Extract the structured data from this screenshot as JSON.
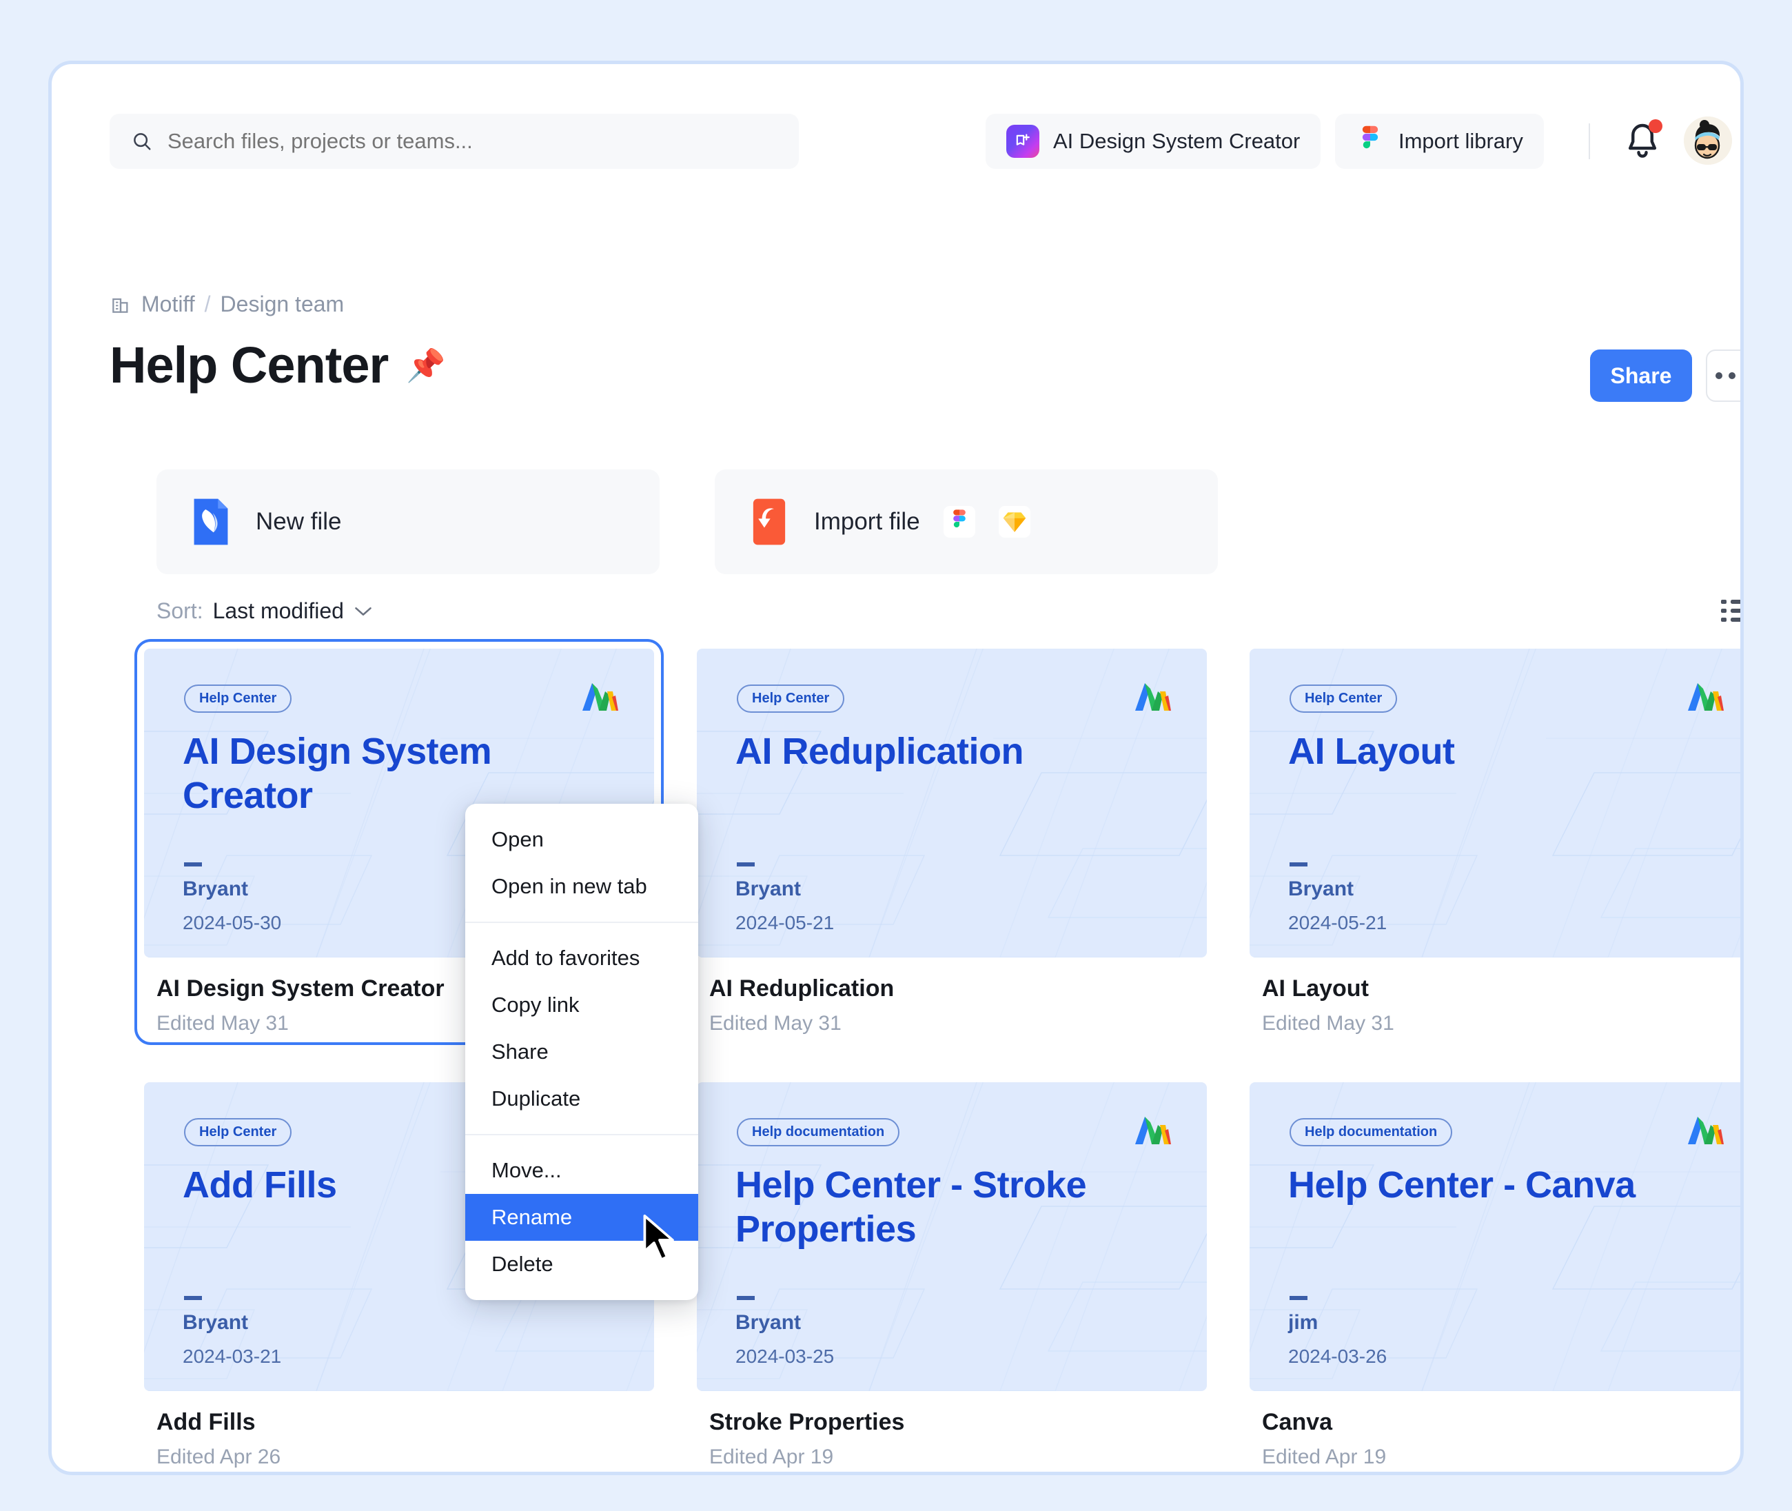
{
  "theme": {
    "page_bg": "#e7f0fd",
    "panel_bg": "#ffffff",
    "panel_border": "#cfe0fa",
    "accent_blue": "#3b7bf7",
    "menu_highlight": "#2f6ff5",
    "thumb_bg": "#dfeafd",
    "thumb_title_color": "#1746cf",
    "muted_text": "#98a2b3"
  },
  "header": {
    "search": {
      "placeholder": "Search files, projects or teams...",
      "value": "",
      "icon": "search-icon"
    },
    "ai_button": {
      "label": "AI Design System Creator",
      "icon": "ai-design-system-icon"
    },
    "import_button": {
      "label": "Import library",
      "icon": "figma-icon"
    },
    "notification": {
      "icon": "bell-icon",
      "has_unread": true,
      "dot_color": "#f04438"
    },
    "account": {
      "icon": "avatar",
      "chevron": "chevron-down-icon"
    }
  },
  "breadcrumb": {
    "icon": "building-icon",
    "items": [
      "Motiff",
      "Design team"
    ],
    "separator": "/"
  },
  "page_title": {
    "text": "Help Center",
    "pin_icon": "pin-icon"
  },
  "title_actions": {
    "share_label": "Share",
    "more_icon": "more-horizontal-icon"
  },
  "actions": [
    {
      "label": "New file",
      "icon": "new-file-icon",
      "badges": []
    },
    {
      "label": "Import file",
      "icon": "import-file-icon",
      "badges": [
        "figma-icon",
        "sketch-icon"
      ]
    }
  ],
  "sort": {
    "label": "Sort:",
    "value": "Last modified",
    "chevron": "chevron-down-icon",
    "view_toggle_icon": "list-view-icon"
  },
  "files": [
    {
      "tag": "Help Center",
      "thumb_title": "AI Design System Creator",
      "author": "Bryant",
      "date": "2024-05-30",
      "name": "AI Design System Creator",
      "edited": "Edited May 31",
      "selected": true
    },
    {
      "tag": "Help Center",
      "thumb_title": "AI Reduplication",
      "author": "Bryant",
      "date": "2024-05-21",
      "name": "AI Reduplication",
      "edited": "Edited May 31",
      "selected": false
    },
    {
      "tag": "Help Center",
      "thumb_title": "AI Layout",
      "author": "Bryant",
      "date": "2024-05-21",
      "name": "AI Layout",
      "edited": "Edited May 31",
      "selected": false
    },
    {
      "tag": "Help Center",
      "thumb_title": "Add Fills",
      "author": "Bryant",
      "date": "2024-03-21",
      "name": "Add Fills",
      "edited": "Edited Apr 26",
      "selected": false
    },
    {
      "tag": "Help documentation",
      "thumb_title": "Help Center -  Stroke Properties",
      "author": "Bryant",
      "date": "2024-03-25",
      "name": "Stroke Properties",
      "edited": "Edited Apr 19",
      "selected": false
    },
    {
      "tag": "Help documentation",
      "thumb_title": "Help Center -  Canva",
      "author": "jim",
      "date": "2024-03-26",
      "name": "Canva",
      "edited": "Edited Apr 19",
      "selected": false
    }
  ],
  "context_menu": {
    "groups": [
      [
        "Open",
        "Open in new tab"
      ],
      [
        "Add to favorites",
        "Copy link",
        "Share",
        "Duplicate"
      ],
      [
        "Move...",
        "Rename",
        "Delete"
      ]
    ],
    "highlighted": "Rename"
  }
}
